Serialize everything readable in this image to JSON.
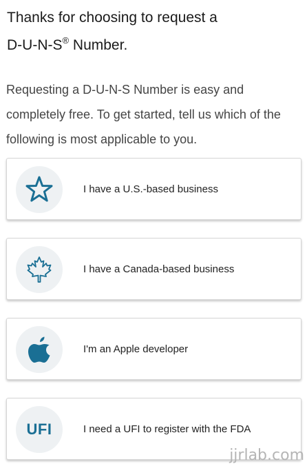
{
  "heading": {
    "line1": "Thanks for choosing to request a",
    "line2_prefix": "D-U-N-S",
    "registered": "®",
    "line2_suffix": " Number."
  },
  "intro": "Requesting a D-U-N-S Number is easy and completely free. To get started, tell us which of the following is most applicable to you.",
  "options": [
    {
      "icon": "star-icon",
      "label": "I have a U.S.-based business"
    },
    {
      "icon": "maple-leaf-icon",
      "label": "I have a Canada-based business"
    },
    {
      "icon": "apple-logo-icon",
      "label": "I'm an Apple developer"
    },
    {
      "icon": "ufi-text-icon",
      "icon_text": "UFI",
      "label": "I need a UFI to register with the FDA"
    }
  ],
  "watermark": "jjrlab.com",
  "colors": {
    "accent": "#1a6f94",
    "icon_bg": "#eef1f3",
    "card_border": "#d6d6d6"
  }
}
